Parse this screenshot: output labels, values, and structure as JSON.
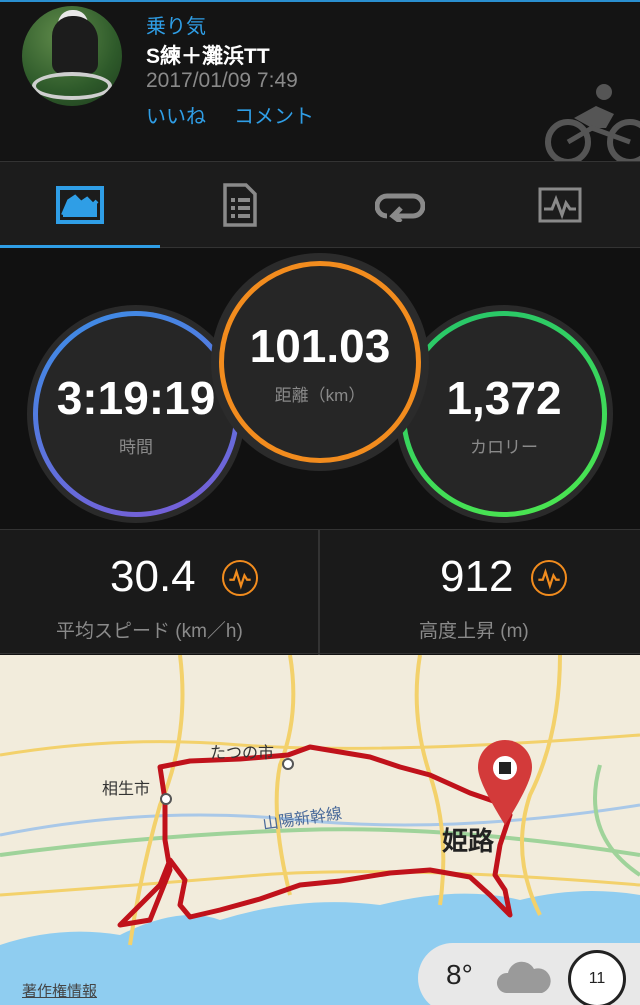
{
  "header": {
    "type": "乗り気",
    "title": "S練＋灘浜TT",
    "datetime": "2017/01/09 7:49",
    "like_label": "いいね",
    "comment_label": "コメント"
  },
  "tabs": [
    {
      "icon": "summary-icon",
      "active": true
    },
    {
      "icon": "details-icon",
      "active": false
    },
    {
      "icon": "laps-icon",
      "active": false
    },
    {
      "icon": "chart-icon",
      "active": false
    }
  ],
  "stats": {
    "time": {
      "value": "3:19:19",
      "label": "時間"
    },
    "distance": {
      "value": "101.03",
      "label": "距離（km）"
    },
    "calories": {
      "value": "1,372",
      "label": "カロリー"
    }
  },
  "metrics": {
    "avg_speed": {
      "value": "30.4",
      "label": "平均スピード (km／h)"
    },
    "elevation": {
      "value": "912",
      "label": "高度上昇 (m)"
    }
  },
  "map": {
    "labels": {
      "tatsuno": "たつの市",
      "aioi": "相生市",
      "shinkansen": "山陽新幹線",
      "himeji": "姫路"
    },
    "credit": "著作権情報",
    "weather": {
      "temp": "8°",
      "dial": "11"
    }
  },
  "colors": {
    "accent": "#2f9ee6",
    "distance_ring": "#f28c1e",
    "time_ring": "#3a8fe6",
    "calorie_ring": "#25c46b",
    "route": "#c0121b"
  }
}
